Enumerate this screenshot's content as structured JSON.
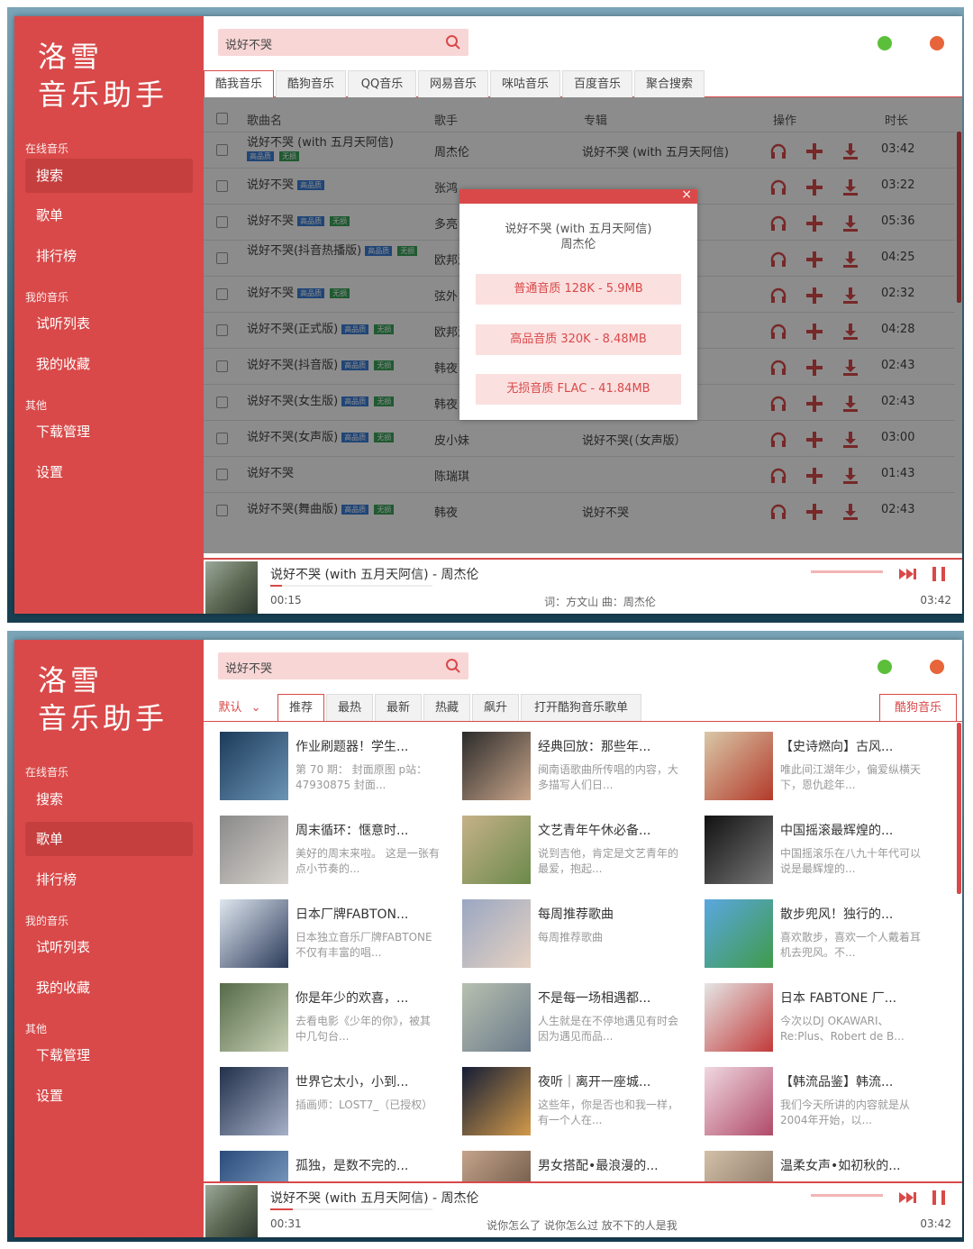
{
  "shot1": {
    "app": {
      "logo_line1": "洛雪",
      "logo_line2": "音乐助手",
      "sidebar": {
        "group_online": "在线音乐",
        "search": "搜索",
        "playlist": "歌单",
        "charts": "排行榜",
        "group_my": "我的音乐",
        "trial_list": "试听列表",
        "favorites": "我的收藏",
        "group_other": "其他",
        "downloads": "下载管理",
        "settings": "设置"
      },
      "search_value": "说好不哭",
      "window_dot_colors": {
        "min": "#5bbf3a",
        "close": "#e8643a"
      },
      "source_tabs": [
        "酷我音乐",
        "酷狗音乐",
        "QQ音乐",
        "网易音乐",
        "咪咕音乐",
        "百度音乐",
        "聚合搜索"
      ],
      "table_headers": {
        "name": "歌曲名",
        "artist": "歌手",
        "album": "专辑",
        "ops": "操作",
        "duration": "时长"
      },
      "rows": [
        {
          "name": "说好不哭 (with 五月天阿信)",
          "badge1": "高品质",
          "badge2": "无损",
          "artist": "周杰伦",
          "album": "说好不哭 (with 五月天阿信)",
          "duration": "03:42"
        },
        {
          "name": "说好不哭",
          "badge1": "高品质",
          "badge2": "",
          "artist": "张鸿",
          "album": "",
          "duration": "03:22"
        },
        {
          "name": "说好不哭",
          "badge1": "高品质",
          "badge2": "无损",
          "artist": "多亮",
          "album": "",
          "duration": "05:36"
        },
        {
          "name": "说好不哭(抖音热播版)",
          "badge1": "高品质",
          "badge2": "无损",
          "artist": "欧邦泽",
          "album": "",
          "duration": "04:25"
        },
        {
          "name": "说好不哭",
          "badge1": "高品质",
          "badge2": "无损",
          "artist": "弦外",
          "album": "",
          "duration": "02:32"
        },
        {
          "name": "说好不哭(正式版)",
          "badge1": "高品质",
          "badge2": "无损",
          "artist": "欧邦泽",
          "album": "",
          "duration": "04:28"
        },
        {
          "name": "说好不哭(抖音版)",
          "badge1": "高品质",
          "badge2": "无损",
          "artist": "韩夜",
          "album": "",
          "duration": "02:43"
        },
        {
          "name": "说好不哭(女生版)",
          "badge1": "高品质",
          "badge2": "无损",
          "artist": "韩夜",
          "album": "说好不哭",
          "duration": "02:43"
        },
        {
          "name": "说好不哭(女声版)",
          "badge1": "高品质",
          "badge2": "无损",
          "artist": "皮小妹",
          "album": "说好不哭(（女声版）",
          "duration": "03:00"
        },
        {
          "name": "说好不哭",
          "badge1": "",
          "badge2": "",
          "artist": "陈瑞琪",
          "album": "",
          "duration": "01:43"
        },
        {
          "name": "说好不哭(舞曲版)",
          "badge1": "高品质",
          "badge2": "无损",
          "artist": "韩夜",
          "album": "说好不哭",
          "duration": "02:43"
        }
      ],
      "modal": {
        "title_line1": "说好不哭 (with 五月天阿信)",
        "title_line2": "周杰伦",
        "close": "×",
        "q1": "普通音质 128K - 5.9MB",
        "q2": "高品音质 320K - 8.48MB",
        "q3": "无损音质 FLAC - 41.84MB"
      },
      "player": {
        "title": "说好不哭 (with 五月天阿信) - 周杰伦",
        "current": "00:15",
        "lyric": "词：方文山 曲：周杰伦",
        "total": "03:42",
        "progress": 0.07
      }
    }
  },
  "shot2": {
    "app": {
      "logo_line1": "洛雪",
      "logo_line2": "音乐助手",
      "sidebar": {
        "group_online": "在线音乐",
        "search": "搜索",
        "playlist": "歌单",
        "charts": "排行榜",
        "group_my": "我的音乐",
        "trial_list": "试听列表",
        "favorites": "我的收藏",
        "group_other": "其他",
        "downloads": "下载管理",
        "settings": "设置"
      },
      "search_value": "说好不哭",
      "sort_select": "默认",
      "sort_tabs": [
        "推荐",
        "最热",
        "最新",
        "热藏",
        "飙升",
        "打开酷狗音乐歌单"
      ],
      "source_tab": "酷狗音乐",
      "playlists": [
        {
          "title": "作业刷题器！学生...",
          "desc": "第 70 期： 封面原图 p站：47930875 封面..."
        },
        {
          "title": "经典回放：那些年...",
          "desc": "闽南语歌曲所传唱的内容，大多描写人们日..."
        },
        {
          "title": "【史诗燃向】古风...",
          "desc": "唯此间江湖年少，偏爱纵横天下，恩仇趁年..."
        },
        {
          "title": "周末循环：惬意时...",
          "desc": "美好的周末来啦。 这是一张有点小节奏的..."
        },
        {
          "title": "文艺青年午休必备...",
          "desc": "说到吉他，肯定是文艺青年的最爱，抱起..."
        },
        {
          "title": "中国摇滚最辉煌的...",
          "desc": "中国摇滚乐在八九十年代可以说是最辉煌的..."
        },
        {
          "title": "日本厂牌FABTON...",
          "desc": "日本独立音乐厂牌FABTONE不仅有丰富的唱..."
        },
        {
          "title": "每周推荐歌曲",
          "desc": "每周推荐歌曲"
        },
        {
          "title": "散步兜风！独行的...",
          "desc": "喜欢散步，喜欢一个人戴着耳机去兜风。不..."
        },
        {
          "title": "你是年少的欢喜，...",
          "desc": "去看电影《少年的你》，被其中几句台..."
        },
        {
          "title": "不是每一场相遇都...",
          "desc": "人生就是在不停地遇见有时会因为遇见而品..."
        },
        {
          "title": "日本 FABTONE 厂...",
          "desc": "今次以DJ OKAWARI、Re:Plus、Robert de B..."
        },
        {
          "title": "世界它太小，小到...",
          "desc": "插画师：LOST7_（已授权）"
        },
        {
          "title": "夜听｜离开一座城...",
          "desc": "这些年，你是否也和我一样，有一个人在..."
        },
        {
          "title": "【韩流品鉴】韩流...",
          "desc": "我们今天所讲的内容就是从2004年开始，以..."
        },
        {
          "title": "孤独，是数不完的...",
          "desc": ""
        },
        {
          "title": "男女搭配•最浪漫的...",
          "desc": ""
        },
        {
          "title": "温柔女声•如初秋的...",
          "desc": ""
        }
      ],
      "player": {
        "title": "说好不哭 (with 五月天阿信) - 周杰伦",
        "current": "00:31",
        "lyric": "说你怎么了 说你怎么过 放不下的人是我",
        "total": "03:42",
        "progress": 0.14
      }
    }
  }
}
